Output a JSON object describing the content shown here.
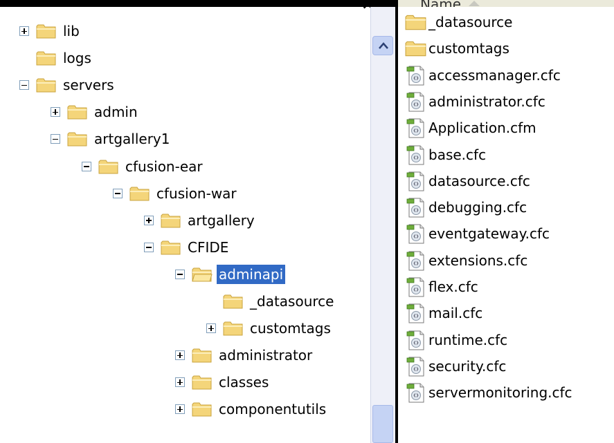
{
  "tree": {
    "items": [
      {
        "label": "lib",
        "expander": "plus",
        "indent": 0
      },
      {
        "label": "logs",
        "expander": "none",
        "indent": 0
      },
      {
        "label": "servers",
        "expander": "minus",
        "indent": 0
      },
      {
        "label": "admin",
        "expander": "plus",
        "indent": 1
      },
      {
        "label": "artgallery1",
        "expander": "minus",
        "indent": 1
      },
      {
        "label": "cfusion-ear",
        "expander": "minus",
        "indent": 2
      },
      {
        "label": "cfusion-war",
        "expander": "minus",
        "indent": 3
      },
      {
        "label": "artgallery",
        "expander": "plus",
        "indent": 4
      },
      {
        "label": "CFIDE",
        "expander": "minus",
        "indent": 4
      },
      {
        "label": "adminapi",
        "expander": "minus",
        "indent": 5,
        "selected": true
      },
      {
        "label": "_datasource",
        "expander": "none",
        "indent": 6
      },
      {
        "label": "customtags",
        "expander": "plus",
        "indent": 6
      },
      {
        "label": "administrator",
        "expander": "plus",
        "indent": 5
      },
      {
        "label": "classes",
        "expander": "plus",
        "indent": 5
      },
      {
        "label": "componentutils",
        "expander": "plus",
        "indent": 5
      }
    ]
  },
  "list": {
    "header": {
      "name_label": "Name"
    },
    "items": [
      {
        "label": "_datasource",
        "type": "folder"
      },
      {
        "label": "customtags",
        "type": "folder"
      },
      {
        "label": "accessmanager.cfc",
        "type": "file"
      },
      {
        "label": "administrator.cfc",
        "type": "file"
      },
      {
        "label": "Application.cfm",
        "type": "file"
      },
      {
        "label": "base.cfc",
        "type": "file"
      },
      {
        "label": "datasource.cfc",
        "type": "file"
      },
      {
        "label": "debugging.cfc",
        "type": "file"
      },
      {
        "label": "eventgateway.cfc",
        "type": "file"
      },
      {
        "label": "extensions.cfc",
        "type": "file"
      },
      {
        "label": "flex.cfc",
        "type": "file"
      },
      {
        "label": "mail.cfc",
        "type": "file"
      },
      {
        "label": "runtime.cfc",
        "type": "file"
      },
      {
        "label": "security.cfc",
        "type": "file"
      },
      {
        "label": "servermonitoring.cfc",
        "type": "file"
      }
    ]
  },
  "background_fragment": "fi",
  "colors": {
    "selection": "#316ac5",
    "folder": "#f4d57a",
    "folder_dark": "#c9a33e"
  }
}
